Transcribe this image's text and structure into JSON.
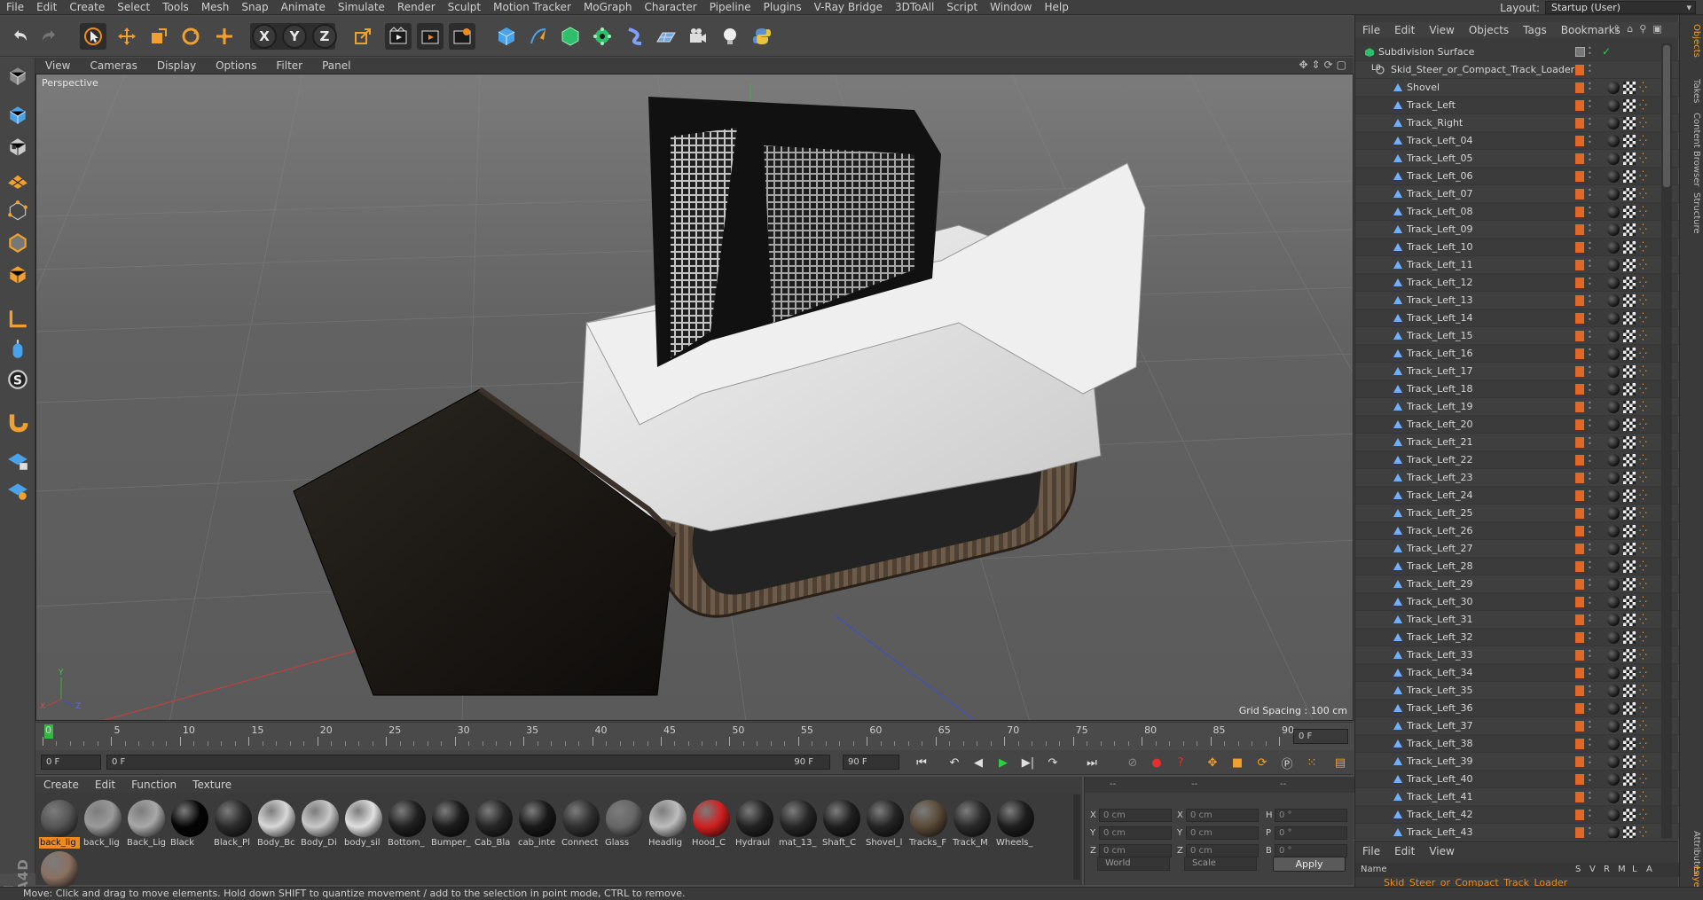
{
  "menubar": {
    "items": [
      "File",
      "Edit",
      "Create",
      "Select",
      "Tools",
      "Mesh",
      "Snap",
      "Animate",
      "Simulate",
      "Render",
      "Sculpt",
      "Motion Tracker",
      "MoGraph",
      "Character",
      "Pipeline",
      "Plugins",
      "V-Ray Bridge",
      "3DToAll",
      "Script",
      "Window",
      "Help"
    ],
    "layout_label": "Layout:",
    "layout_value": "Startup (User)"
  },
  "toolbar": {
    "axis_x": "X",
    "axis_y": "Y",
    "axis_z": "Z"
  },
  "viewport": {
    "menu": [
      "View",
      "Cameras",
      "Display",
      "Options",
      "Filter",
      "Panel"
    ],
    "label": "Perspective",
    "grid_spacing": "Grid Spacing : 100 cm"
  },
  "timeline": {
    "ticks": [
      "0",
      "5",
      "10",
      "15",
      "20",
      "25",
      "30",
      "35",
      "40",
      "45",
      "50",
      "55",
      "60",
      "65",
      "70",
      "75",
      "80",
      "85",
      "90"
    ],
    "end_field": "0 F"
  },
  "playbar": {
    "current": "0 F",
    "range_start": "0 F",
    "range_end": "90 F",
    "end": "90 F"
  },
  "materials": {
    "menu": [
      "Create",
      "Edit",
      "Function",
      "Texture"
    ],
    "items": [
      {
        "name": "back_lig",
        "color": "#555555"
      },
      {
        "name": "back_lig",
        "color": "#9a9a9a"
      },
      {
        "name": "Back_Lig",
        "color": "#a8a8a8"
      },
      {
        "name": "Black",
        "color": "#050505"
      },
      {
        "name": "Black_Pl",
        "color": "#2a2a2a"
      },
      {
        "name": "Body_Bc",
        "color": "#d8d8d8"
      },
      {
        "name": "Body_Di",
        "color": "#c8c8c8"
      },
      {
        "name": "body_sil",
        "color": "#e0e0e0"
      },
      {
        "name": "Bottom_",
        "color": "#202020"
      },
      {
        "name": "Bumper_",
        "color": "#1c1c1c"
      },
      {
        "name": "Cab_Bla",
        "color": "#252525"
      },
      {
        "name": "cab_inte",
        "color": "#181818"
      },
      {
        "name": "Connect",
        "color": "#303030"
      },
      {
        "name": "Glass",
        "color": "#666666"
      },
      {
        "name": "Headlig",
        "color": "#bdbdbd"
      },
      {
        "name": "Hood_C",
        "color": "#d02020"
      },
      {
        "name": "Hydraul",
        "color": "#222222"
      },
      {
        "name": "mat_13_",
        "color": "#262626"
      },
      {
        "name": "Shaft_C",
        "color": "#1f1f1f"
      },
      {
        "name": "Shovel_l",
        "color": "#242424"
      },
      {
        "name": "Tracks_F",
        "color": "#5a4a38"
      },
      {
        "name": "Track_M",
        "color": "#2a2a2a"
      },
      {
        "name": "Wheels_",
        "color": "#1e1e1e"
      },
      {
        "name": "",
        "color": "#8a7060"
      }
    ]
  },
  "coordinates": {
    "header_left": "--",
    "header_mid": "--",
    "header_right": "--",
    "rows": [
      {
        "a": "X",
        "av": "0 cm",
        "b": "X",
        "bv": "0 cm",
        "c": "H",
        "cv": "0 °"
      },
      {
        "a": "Y",
        "av": "0 cm",
        "b": "Y",
        "bv": "0 cm",
        "c": "P",
        "cv": "0 °"
      },
      {
        "a": "Z",
        "av": "0 cm",
        "b": "Z",
        "bv": "0 cm",
        "c": "B",
        "cv": "0 °"
      }
    ],
    "space": "World",
    "mode": "Scale",
    "apply": "Apply"
  },
  "objects": {
    "menu": [
      "File",
      "Edit",
      "View",
      "Objects",
      "Tags",
      "Bookmarks"
    ],
    "root": "Subdivision Surface",
    "group": "Skid_Steer_or_Compact_Track_Loader",
    "group_prefix": "L0",
    "items": [
      "Shovel",
      "Track_Left",
      "Track_Right",
      "Track_Left_04",
      "Track_Left_05",
      "Track_Left_06",
      "Track_Left_07",
      "Track_Left_08",
      "Track_Left_09",
      "Track_Left_10",
      "Track_Left_11",
      "Track_Left_12",
      "Track_Left_13",
      "Track_Left_14",
      "Track_Left_15",
      "Track_Left_16",
      "Track_Left_17",
      "Track_Left_18",
      "Track_Left_19",
      "Track_Left_20",
      "Track_Left_21",
      "Track_Left_22",
      "Track_Left_23",
      "Track_Left_24",
      "Track_Left_25",
      "Track_Left_26",
      "Track_Left_27",
      "Track_Left_28",
      "Track_Left_29",
      "Track_Left_30",
      "Track_Left_31",
      "Track_Left_32",
      "Track_Left_33",
      "Track_Left_34",
      "Track_Left_35",
      "Track_Left_36",
      "Track_Left_37",
      "Track_Left_38",
      "Track_Left_39",
      "Track_Left_40",
      "Track_Left_41",
      "Track_Left_42",
      "Track_Left_43"
    ]
  },
  "side_tabs": [
    "Objects",
    "Takes",
    "Content Browser",
    "Structure",
    "Attributes",
    "Layers"
  ],
  "attributes": {
    "menu": [
      "File",
      "Edit",
      "View"
    ],
    "col_name": "Name",
    "col_s": "S",
    "col_v": "V",
    "col_r": "R",
    "col_m": "M",
    "col_l": "L",
    "col_a": "A",
    "row": "Skid_Steer_or_Compact_Track_Loader"
  },
  "status": "Move: Click and drag to move elements. Hold down SHIFT to quantize movement / add to the selection in point mode, CTRL to remove.",
  "colors": {
    "accent": "#f08a1c",
    "layer": "#e0692a",
    "play": "#2ecc40"
  }
}
